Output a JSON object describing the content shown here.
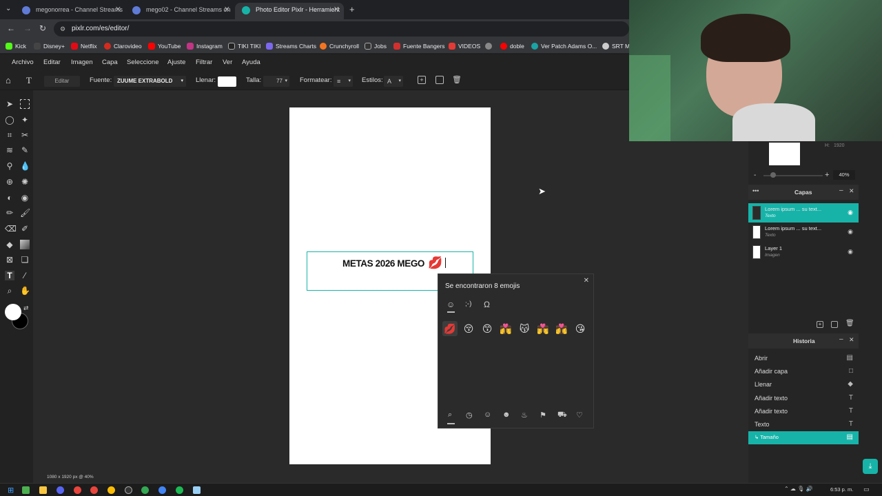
{
  "browser": {
    "tabs": [
      {
        "title": "megonorrea - Channel Streams"
      },
      {
        "title": "mego02 - Channel Streams on"
      },
      {
        "title": "Photo Editor Pixlr - Herramient"
      }
    ],
    "url": "pixlr.com/es/editor/",
    "bookmarks": [
      "Kick",
      "Disney+",
      "Netflix",
      "Clarovideo",
      "YouTube",
      "Instagram",
      "TIKI TIKI",
      "Streams Charts",
      "Crunchyroll",
      "Jobs",
      "Fuente Bangers",
      "VIDEOS",
      "doble",
      "Ver Patch Adams O...",
      "SRT Mi"
    ]
  },
  "menu": {
    "items": [
      "Archivo",
      "Editar",
      "Imagen",
      "Capa",
      "Seleccione",
      "Ajuste",
      "Filtrar",
      "Ver",
      "Ayuda"
    ]
  },
  "toolbar": {
    "edit_label": "Editar",
    "font_label": "Fuente:",
    "font_value": "ZUUME EXTRABOLD",
    "fill_label": "Llenar:",
    "size_label": "Talla:",
    "size_value": "77",
    "format_label": "Formatear:",
    "styles_label": "Estilos:"
  },
  "canvas": {
    "text": "METAS 2026 MEGO",
    "status": "1080 x 1920 px @ 40%"
  },
  "emoji_picker": {
    "header": "Se encontraron 8 emojis",
    "results": [
      "💋",
      "😚",
      "😙",
      "👩‍❤️‍💋‍👨",
      "😽",
      "👨‍❤️‍💋‍👨",
      "👩‍❤️‍💋‍👩",
      "😘"
    ]
  },
  "navigator": {
    "height_label": "H:",
    "height_value": "1920",
    "zoom": "40%"
  },
  "layers": {
    "title": "Capas",
    "items": [
      {
        "name": "Lorem ipsum ... su text...",
        "type": "Texto"
      },
      {
        "name": "Lorem ipsum ... su text...",
        "type": "Texto"
      },
      {
        "name": "Layer 1",
        "type": "Imagen"
      }
    ]
  },
  "history": {
    "title": "Historia",
    "items": [
      "Abrir",
      "Añadir capa",
      "Llenar",
      "Añadir texto",
      "Añadir texto",
      "Texto",
      "↳ Tamaño"
    ]
  },
  "taskbar": {
    "time": "6:53 p. m."
  },
  "colors": {
    "accent": "#17b3a8",
    "panel": "#252525",
    "workspace": "#2a2a2a"
  }
}
